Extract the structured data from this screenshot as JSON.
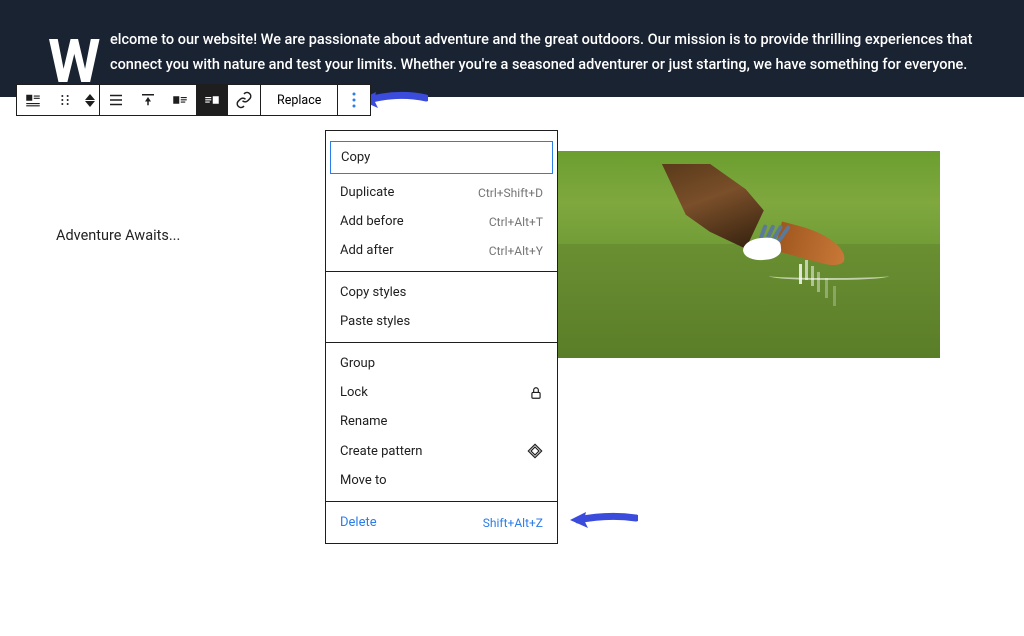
{
  "hero": {
    "dropcap": "W",
    "text": "elcome to our website! We are passionate about adventure and the great outdoors. Our mission is to provide thrilling experiences that connect you with nature and test your limits. Whether you're a seasoned adventurer or just starting, we have something for everyone."
  },
  "toolbar": {
    "replace_label": "Replace"
  },
  "content": {
    "caption": "Adventure Awaits..."
  },
  "dropdown": {
    "section1": [
      {
        "label": "Copy",
        "shortcut": "",
        "highlighted": true
      },
      {
        "label": "Duplicate",
        "shortcut": "Ctrl+Shift+D"
      },
      {
        "label": "Add before",
        "shortcut": "Ctrl+Alt+T"
      },
      {
        "label": "Add after",
        "shortcut": "Ctrl+Alt+Y"
      }
    ],
    "section2": [
      {
        "label": "Copy styles",
        "shortcut": ""
      },
      {
        "label": "Paste styles",
        "shortcut": ""
      }
    ],
    "section3": [
      {
        "label": "Group",
        "shortcut": ""
      },
      {
        "label": "Lock",
        "icon": "lock"
      },
      {
        "label": "Rename",
        "shortcut": ""
      },
      {
        "label": "Create pattern",
        "icon": "diamond"
      },
      {
        "label": "Move to",
        "shortcut": ""
      }
    ],
    "section4": [
      {
        "label": "Delete",
        "shortcut": "Shift+Alt+Z",
        "delete": true
      }
    ]
  }
}
